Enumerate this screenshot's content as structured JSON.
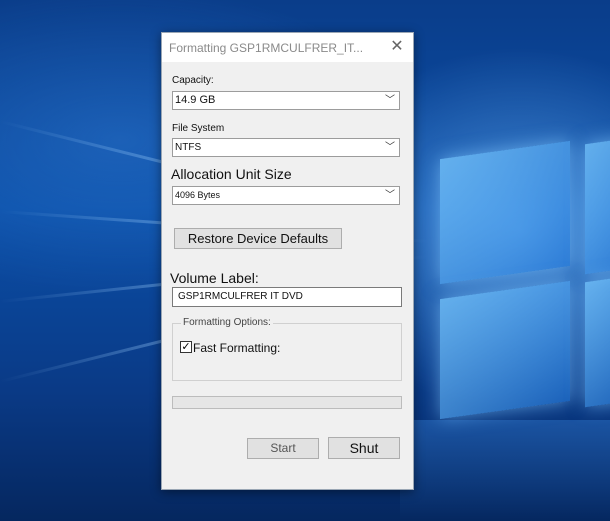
{
  "dialog": {
    "title": "Formatting GSP1RMCULFRER_IT...",
    "close_icon": "close-icon"
  },
  "capacity": {
    "label": "Capacity:",
    "value": "14.9 GB"
  },
  "file_system": {
    "label": "File System",
    "value": "NTFS"
  },
  "allocation": {
    "label": "Allocation Unit Size",
    "value": "4096 Bytes"
  },
  "restore_button": {
    "label": "Restore Device Defaults"
  },
  "volume_label": {
    "label": "Volume Label:",
    "value": "GSP1RMCULFRER IT DVD"
  },
  "options": {
    "legend": "Formatting Options:",
    "fast_formatting": {
      "label": "Fast Formatting:",
      "checked": true,
      "check_glyph": "✓"
    }
  },
  "progress": {
    "value": 0
  },
  "buttons": {
    "start": "Start",
    "shut": "Shut"
  },
  "colors": {
    "desktop": "#0b4fa8",
    "dialog_bg": "#f0f0f0",
    "progress_fill": "#06b025"
  }
}
